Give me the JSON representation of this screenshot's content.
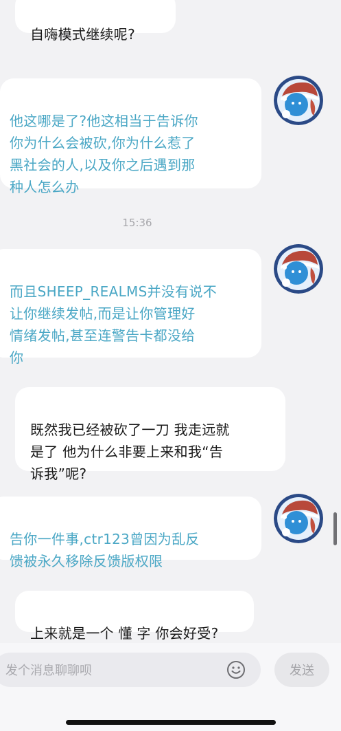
{
  "messages": [
    {
      "side": "right",
      "text": "自嗨模式继续呢?"
    },
    {
      "side": "left",
      "text": "他这哪是了?他这相当于告诉你\n你为什么会被砍,你为什么惹了\n黑社会的人,以及你之后遇到那\n种人怎么办"
    },
    {
      "side": "left",
      "text": "而且SHEEP_REALMS并没有说不\n让你继续发帖,而是让你管理好\n情绪发帖,甚至连警告卡都没给\n你"
    },
    {
      "side": "right",
      "text": "既然我已经被砍了一刀 我走远就\n是了 他为什么非要上来和我“告\n诉我”呢?"
    },
    {
      "side": "left",
      "text": "告你一件事,ctr123曾因为乱反\n馈被永久移除反馈版权限"
    },
    {
      "side": "right",
      "text": "上来就是一个 懂 字 你会好受?"
    }
  ],
  "timestamp": "15:36",
  "input": {
    "placeholder": "发个消息聊聊呗",
    "value": ""
  },
  "send_label": "发送",
  "icons": {
    "emoji": "smiley-face-icon",
    "avatar": "snowman-avatar-icon"
  },
  "colors": {
    "left_text": "#4aa7c5",
    "right_text": "#1a1a1a",
    "background": "#f2f2f4"
  }
}
